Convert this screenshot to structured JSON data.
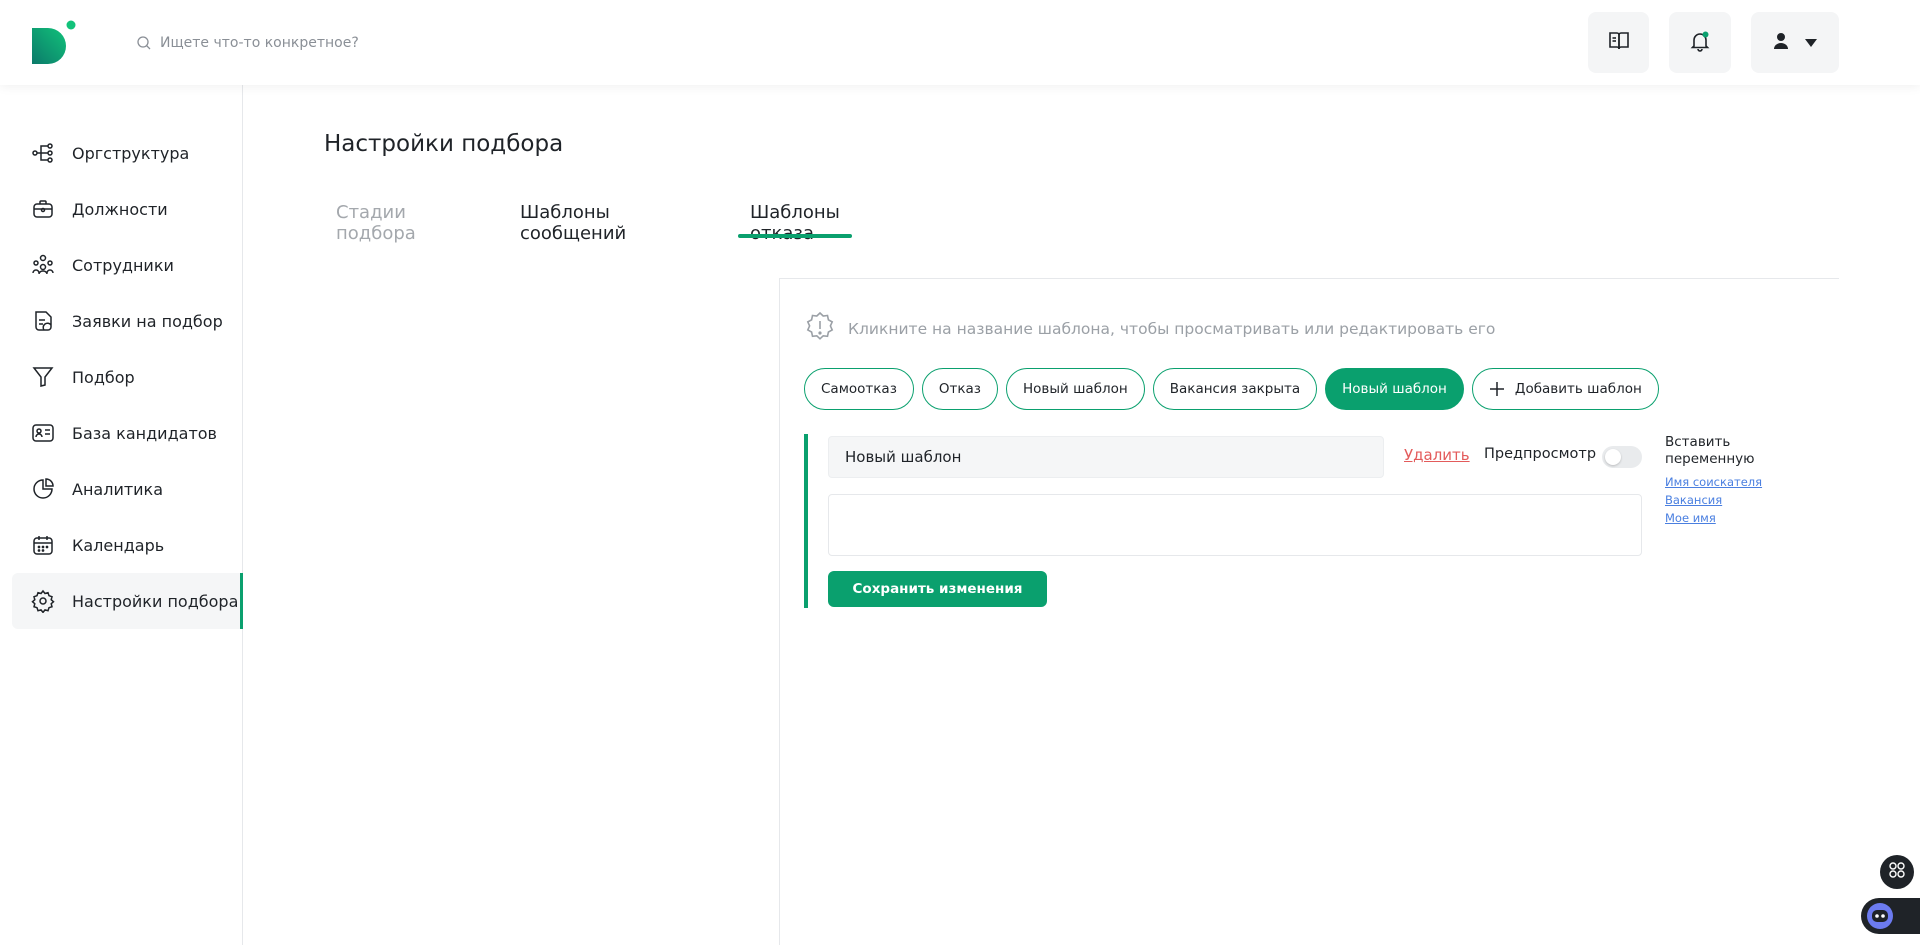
{
  "header": {
    "search_placeholder": "Ищете что-то конкретное?"
  },
  "sidebar": {
    "items": [
      {
        "label": "Оргструктура",
        "icon": "org-structure-icon"
      },
      {
        "label": "Должности",
        "icon": "briefcase-icon"
      },
      {
        "label": "Сотрудники",
        "icon": "employees-icon"
      },
      {
        "label": "Заявки на подбор",
        "icon": "request-document-icon"
      },
      {
        "label": "Подбор",
        "icon": "funnel-icon"
      },
      {
        "label": "База кандидатов",
        "icon": "id-card-icon"
      },
      {
        "label": "Аналитика",
        "icon": "pie-chart-icon"
      },
      {
        "label": "Календарь",
        "icon": "calendar-icon"
      },
      {
        "label": "Настройки подбора",
        "icon": "gear-icon",
        "active": true
      }
    ]
  },
  "main": {
    "title": "Настройки подбора",
    "tabs": [
      {
        "label": "Стадии подбора",
        "state": "disabled"
      },
      {
        "label": "Шаблоны сообщений",
        "state": "normal"
      },
      {
        "label": "Шаблоны отказа",
        "state": "active"
      }
    ],
    "hint": "Кликните на название шаблона, чтобы просматривать или редактировать его",
    "chips": [
      {
        "label": "Самоотказ",
        "selected": false
      },
      {
        "label": "Отказ",
        "selected": false
      },
      {
        "label": "Новый шаблон",
        "selected": false
      },
      {
        "label": "Вакансия закрыта",
        "selected": false
      },
      {
        "label": "Новый шаблон",
        "selected": true
      }
    ],
    "add_template_label": "Добавить шаблон",
    "editor": {
      "name_value": "Новый шаблон",
      "delete_label": "Удалить",
      "preview_label": "Предпросмотр",
      "preview_enabled": false,
      "body_value": "",
      "save_label": "Сохранить изменения",
      "vars_title": "Вставить переменную",
      "vars": [
        "Имя соискателя",
        "Вакансия",
        "Мое имя"
      ]
    }
  },
  "colors": {
    "accent": "#0aa06e",
    "danger": "#e35b5b",
    "link": "#4a7fe0"
  }
}
